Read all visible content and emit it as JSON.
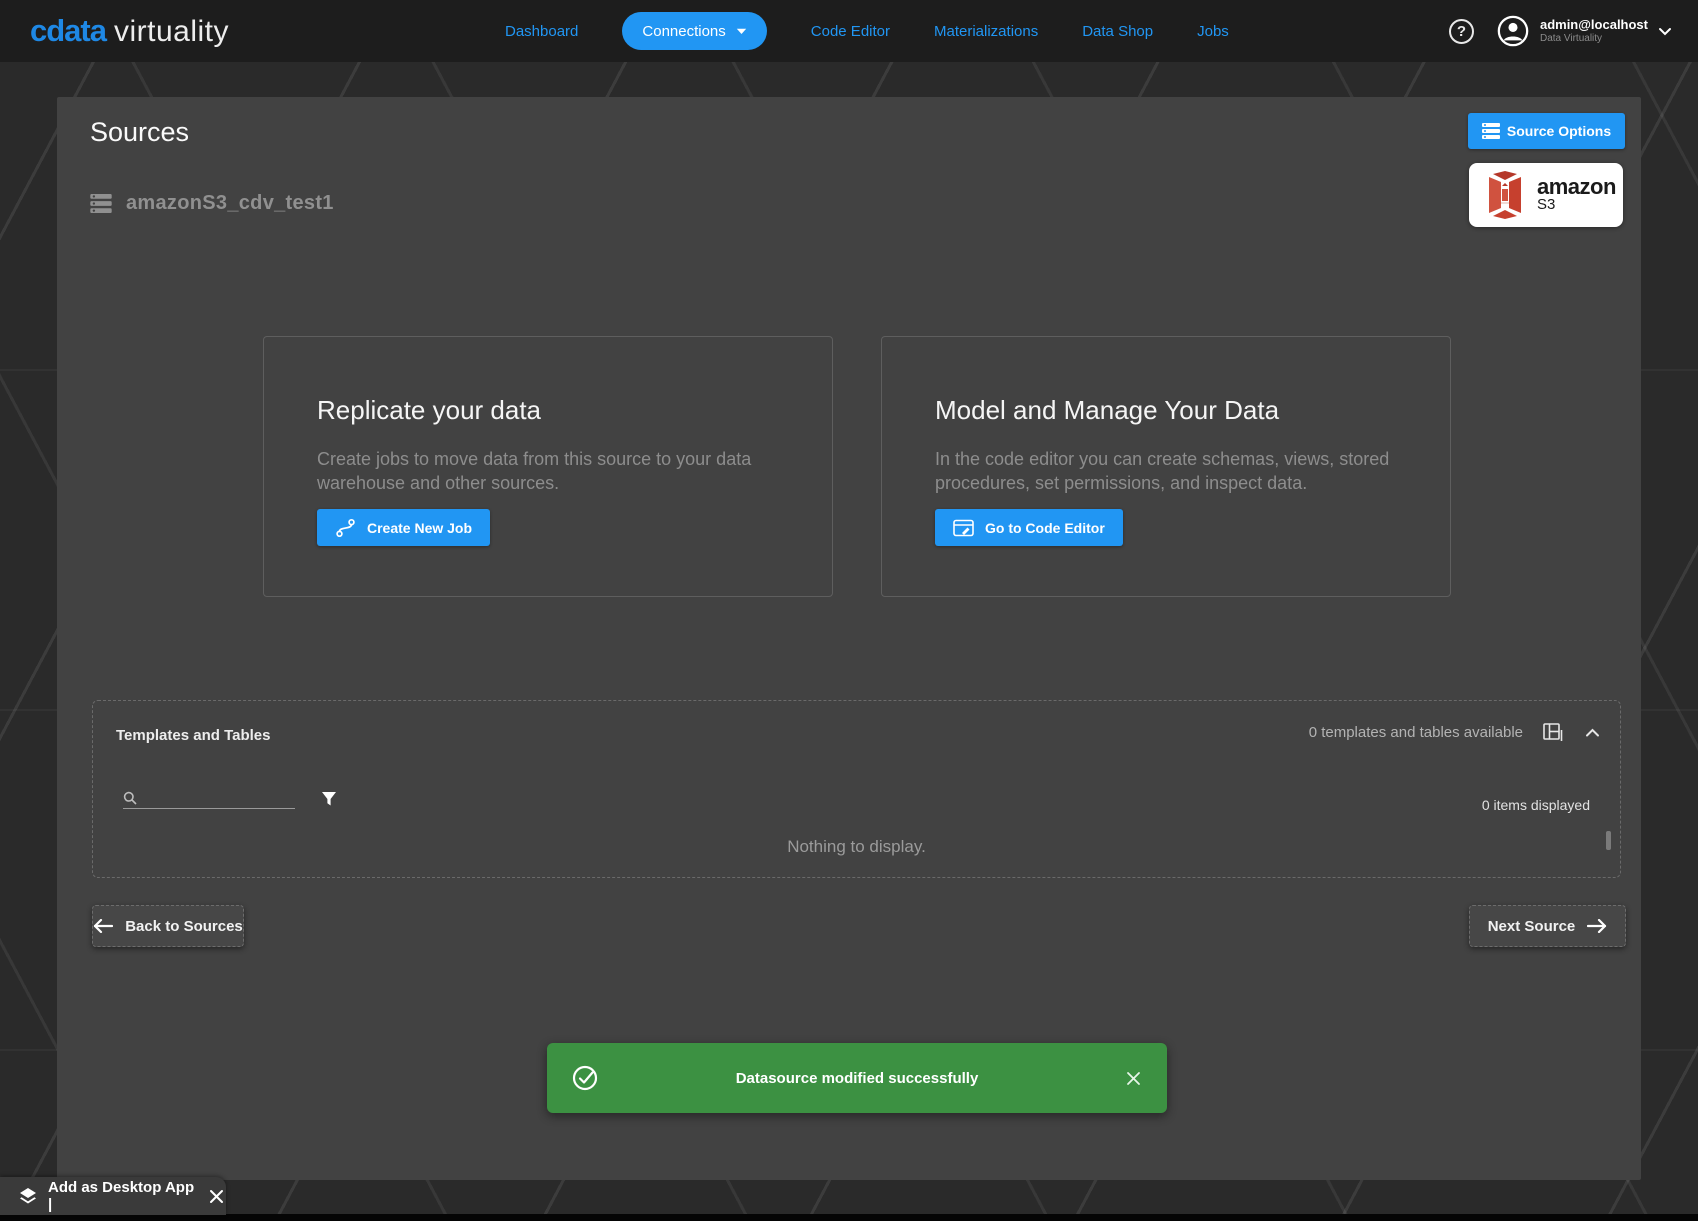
{
  "navbar": {
    "logo": {
      "part1": "cdata",
      "part2": "virtuality"
    },
    "items": [
      {
        "label": "Dashboard"
      },
      {
        "label": "Connections"
      },
      {
        "label": "Code Editor"
      },
      {
        "label": "Materializations"
      },
      {
        "label": "Data Shop"
      },
      {
        "label": "Jobs"
      }
    ],
    "help_glyph": "?",
    "user": {
      "name": "admin@localhost",
      "org": "Data Virtuality"
    }
  },
  "page": {
    "title": "Sources",
    "source_name": "amazonS3_cdv_test1",
    "source_options_label": "Source Options",
    "s3_logo": {
      "line1": "amazon",
      "line2": "S3"
    }
  },
  "cards": [
    {
      "title": "Replicate your data",
      "description": "Create jobs to move data from this source to your data warehouse and other sources.",
      "button": "Create New Job"
    },
    {
      "title": "Model and Manage Your Data",
      "description": "In the code editor you can create schemas, views, stored procedures, set permissions, and inspect data.",
      "button": "Go to Code Editor"
    }
  ],
  "templates_panel": {
    "title": "Templates and Tables",
    "available_text": "0 templates and tables available",
    "items_displayed_text": "0 items displayed",
    "empty_text": "Nothing to display.",
    "search_placeholder": ""
  },
  "footer": {
    "back_button": "Back to Sources",
    "next_button": "Next Source"
  },
  "toast": {
    "message": "Datasource modified successfully"
  },
  "desktop_bar": {
    "label": "Add as Desktop App |"
  },
  "colors": {
    "accent_blue": "#2196f3",
    "toast_green": "#3c9142",
    "s3_red": "#c6402e",
    "panel_gray": "#424242",
    "navbar_black": "#1d1d1d"
  }
}
